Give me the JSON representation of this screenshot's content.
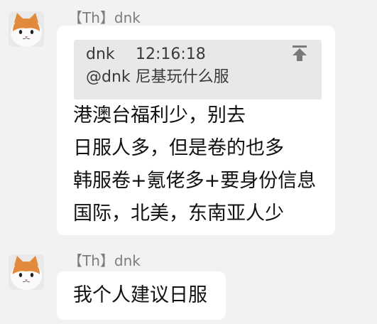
{
  "messages": [
    {
      "sender": "【Th】dnk",
      "quote": {
        "author": "dnk",
        "time": "12:16:18",
        "text": "@dnk 尼基玩什么服"
      },
      "lines": [
        "港澳台福利少，别去",
        "日服人多，但是卷的也多",
        "韩服卷+氪佬多+要身份信息",
        "国际，北美，东南亚人少"
      ]
    },
    {
      "sender": "【Th】dnk",
      "lines": [
        "我个人建议日服"
      ]
    }
  ],
  "icons": {
    "avatar": "cat-avatar-icon",
    "jump": "jump-to-original-icon"
  },
  "colors": {
    "background": "#f2f2f2",
    "bubble": "#ffffff",
    "quote_background": "#e8e8e8",
    "sender_text": "#7d7d7d",
    "cat_fur_orange": "#e28a3c"
  }
}
